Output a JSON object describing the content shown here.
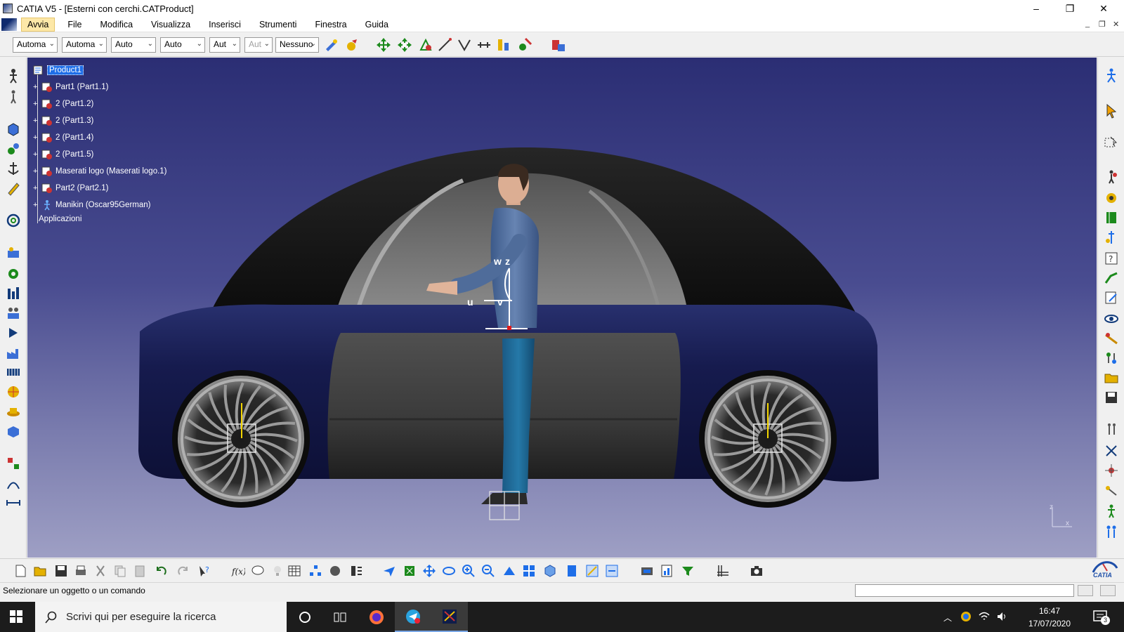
{
  "window": {
    "title": "CATIA V5 - [Esterni con cerchi.CATProduct]",
    "minimize": "–",
    "restore": "❐",
    "close": "✕"
  },
  "menu": {
    "items": [
      "Avvia",
      "File",
      "Modifica",
      "Visualizza",
      "Inserisci",
      "Strumenti",
      "Finestra",
      "Guida"
    ]
  },
  "toolbar": {
    "combos": [
      "Automa",
      "Automa",
      "Auto",
      "Auto",
      "Aut",
      "Aut",
      "Nessuno"
    ]
  },
  "tree": {
    "root": "Product1",
    "items": [
      "Part1 (Part1.1)",
      "2 (Part1.2)",
      "2 (Part1.3)",
      "2 (Part1.4)",
      "2 (Part1.5)",
      "Maserati logo (Maserati logo.1)",
      "Part2 (Part2.1)",
      "Manikin (Oscar95German)"
    ],
    "applications": "Applicazioni"
  },
  "manikin_axes": {
    "w": "w",
    "z": "z",
    "u": "u",
    "v": "v"
  },
  "compass": {
    "z": "z",
    "x": "x"
  },
  "status": {
    "message": "Selezionare un oggetto o un comando"
  },
  "brand": {
    "catia": "CATIA"
  },
  "taskbar": {
    "search_placeholder": "Scrivi qui per eseguire la ricerca",
    "time": "16:47",
    "date": "17/07/2020",
    "notifications": "3"
  },
  "colors": {
    "viewport_top": "#2b2e74",
    "viewport_bottom": "#9e9fc4",
    "car_body": "#1a1f5c",
    "manikin_shirt": "#4f6c9a",
    "manikin_pants": "#1f6e9c",
    "selection": "#1e6ee8"
  }
}
